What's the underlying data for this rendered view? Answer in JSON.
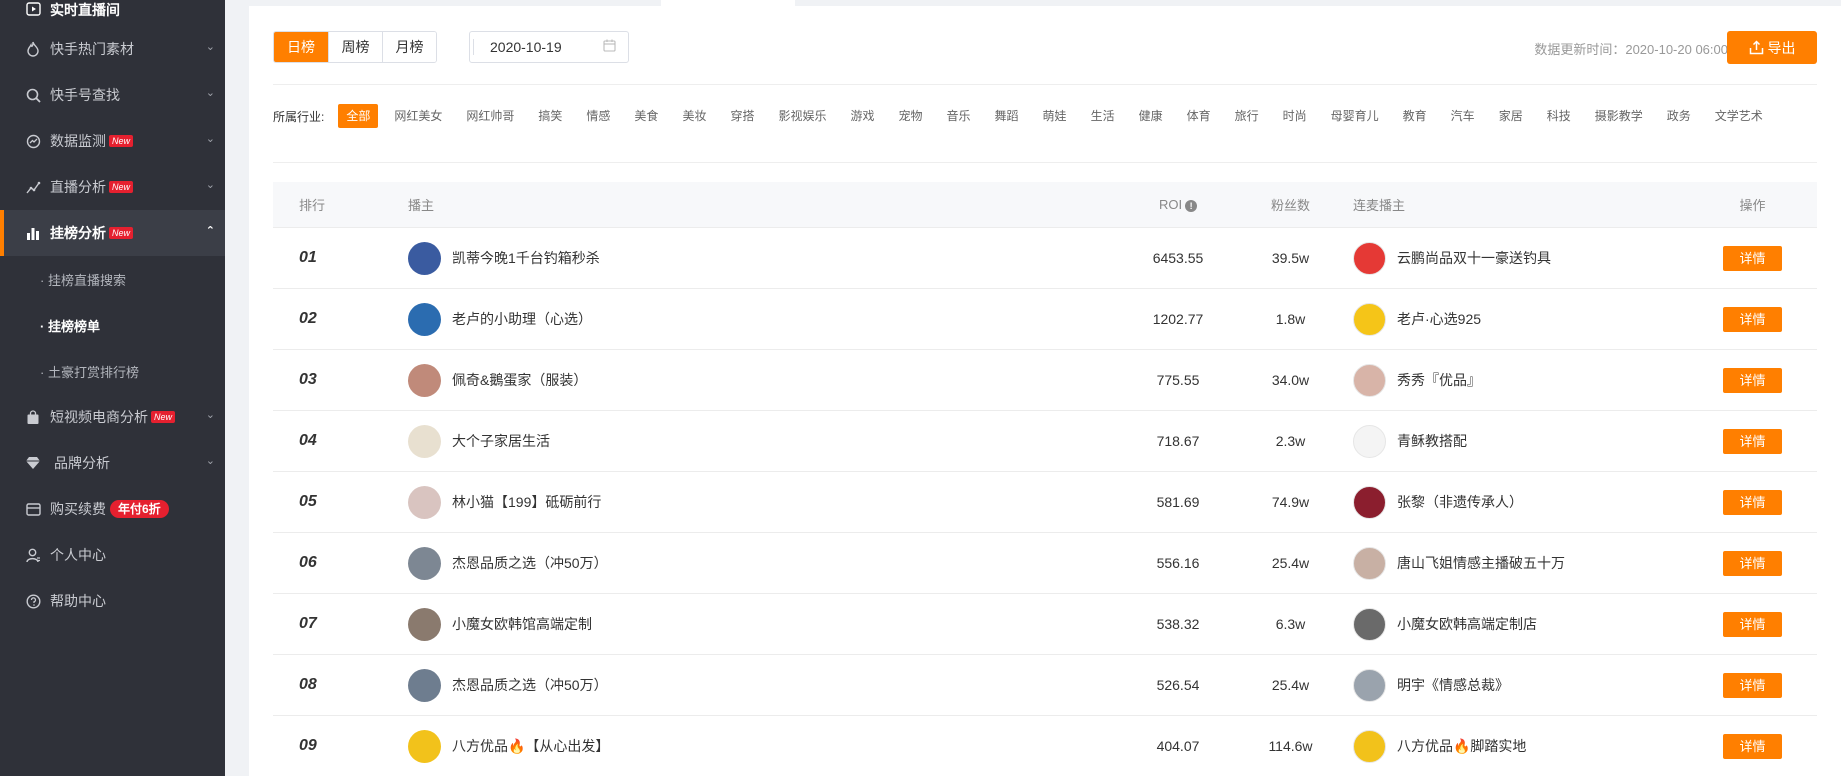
{
  "sidebar": {
    "items": [
      {
        "label": "实时直播间",
        "icon": "play-screen-icon"
      },
      {
        "label": "快手热门素材",
        "icon": "flame-icon"
      },
      {
        "label": "快手号查找",
        "icon": "search-icon"
      },
      {
        "label": "数据监测",
        "icon": "monitor-icon",
        "badge": "New"
      },
      {
        "label": "直播分析",
        "icon": "line-chart-icon",
        "badge": "New"
      },
      {
        "label": "挂榜分析",
        "icon": "bar-chart-icon",
        "badge": "New"
      },
      {
        "label": "短视频电商分析",
        "icon": "shopping-bag-icon",
        "badge": "New"
      },
      {
        "label": "品牌分析",
        "icon": "diamond-icon"
      },
      {
        "label": "购买续费",
        "icon": "card-icon",
        "badge": "年付6折"
      },
      {
        "label": "个人中心",
        "icon": "user-icon"
      },
      {
        "label": "帮助中心",
        "icon": "help-icon"
      }
    ],
    "subitems": [
      {
        "label": "· 挂榜直播搜索"
      },
      {
        "label": "· 挂榜榜单"
      },
      {
        "label": "· 土豪打赏排行榜"
      }
    ]
  },
  "toolbar": {
    "tabs": [
      "日榜",
      "周榜",
      "月榜"
    ],
    "date": "2020-10-19",
    "update_time": "数据更新时间：2020-10-20 06:00",
    "export_label": "导出"
  },
  "industry": {
    "label": "所属行业:",
    "options": [
      "全部",
      "网红美女",
      "网红帅哥",
      "搞笑",
      "情感",
      "美食",
      "美妆",
      "穿搭",
      "影视娱乐",
      "游戏",
      "宠物",
      "音乐",
      "舞蹈",
      "萌娃",
      "生活",
      "健康",
      "体育",
      "旅行",
      "时尚",
      "母婴育儿",
      "教育",
      "汽车",
      "家居",
      "科技",
      "摄影教学",
      "政务",
      "文学艺术"
    ]
  },
  "table": {
    "headers": {
      "rank": "排行",
      "anchor": "播主",
      "roi": "ROI",
      "fans": "粉丝数",
      "partner": "连麦播主",
      "op": "操作"
    },
    "detail_label": "详情",
    "rows": [
      {
        "rank": "01",
        "anchor": "凯蒂今晚1千台钓箱秒杀",
        "roi": "6453.55",
        "fans": "39.5w",
        "partner": "云鹏尚品双十一豪送钓具"
      },
      {
        "rank": "02",
        "anchor": "老卢的小助理（心选）",
        "roi": "1202.77",
        "fans": "1.8w",
        "partner": "老卢·心选925"
      },
      {
        "rank": "03",
        "anchor": "佩奇&鵝蛋家（服装）",
        "roi": "775.55",
        "fans": "34.0w",
        "partner": "秀秀『优品』"
      },
      {
        "rank": "04",
        "anchor": "大个子家居生活",
        "roi": "718.67",
        "fans": "2.3w",
        "partner": "青稣教搭配"
      },
      {
        "rank": "05",
        "anchor": "林小猫【199】砥砺前行",
        "roi": "581.69",
        "fans": "74.9w",
        "partner": "张黎（非遗传承人）"
      },
      {
        "rank": "06",
        "anchor": "杰恩品质之选（冲50万）",
        "roi": "556.16",
        "fans": "25.4w",
        "partner": "唐山飞姐情感主播破五十万"
      },
      {
        "rank": "07",
        "anchor": "小魔女欧韩馆高端定制",
        "roi": "538.32",
        "fans": "6.3w",
        "partner": "小魔女欧韩高端定制店"
      },
      {
        "rank": "08",
        "anchor": "杰恩品质之选（冲50万）",
        "roi": "526.54",
        "fans": "25.4w",
        "partner": "明宇《情感总裁》"
      },
      {
        "rank": "09",
        "anchor": "八方优品🔥【从心出发】",
        "roi": "404.07",
        "fans": "114.6w",
        "partner": "八方优品🔥脚踏实地"
      }
    ]
  },
  "colors": {
    "accent": "#ff7f00",
    "sidebar_bg": "#2f3139",
    "badge_red": "#e5202f"
  }
}
